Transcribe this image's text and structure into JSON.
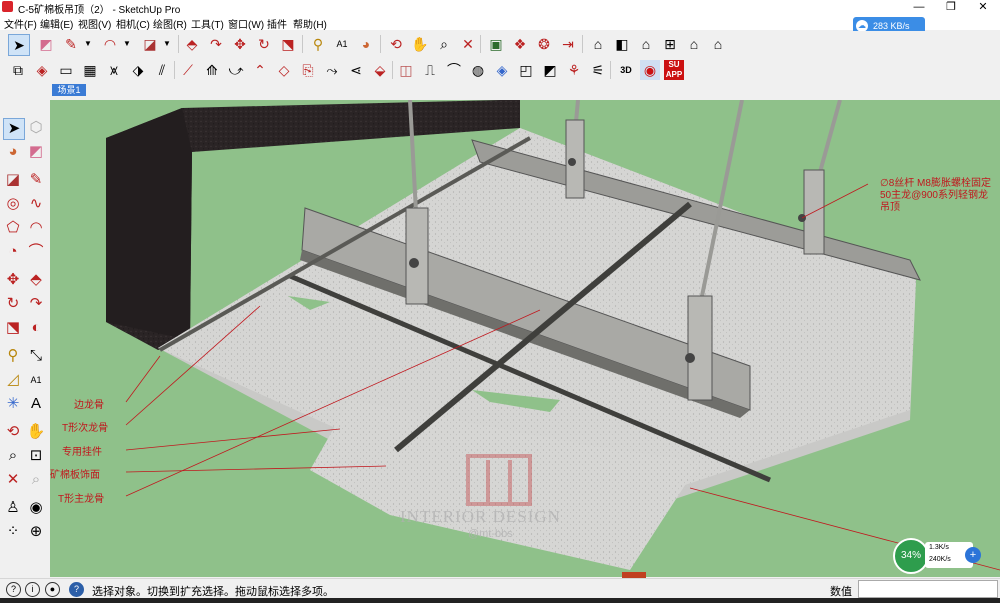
{
  "window": {
    "title": "C-5矿棉板吊顶（2） - SketchUp Pro",
    "controls": {
      "minimize": "—",
      "maximize": "❐",
      "close": "✕"
    }
  },
  "menu": [
    "文件(F)",
    "编辑(E)",
    "视图(V)",
    "相机(C)",
    "绘图(R)",
    "工具(T)",
    "窗口(W)",
    "插件",
    "帮助(H)"
  ],
  "net_speed": "283 KB/s",
  "scene_tab": "场景1",
  "viewport": {
    "annotation_right_lines": [
      "∅8丝杆 M8膨胀螺栓固定",
      "50主龙@900系列轻钢龙",
      "吊顶"
    ],
    "labels_left": [
      "边龙骨",
      "T形次龙骨",
      "专用挂件",
      "矿棉板饰面",
      "T形主龙骨"
    ],
    "watermark_title": "INTERIOR DESIGN",
    "watermark_sub": "@mt-bbs"
  },
  "speed_widget": {
    "percent": "34%",
    "up": "1.3K/s",
    "down": "240K/s"
  },
  "status": {
    "text": "选择对象。切换到扩充选择。拖动鼠标选择多项。",
    "vcb_label": "数值",
    "ime": "中"
  },
  "colors": {
    "accent": "#3a7bd5",
    "annotation": "#c0181e",
    "wall": "#2c2527",
    "board": "#d9d9d7",
    "green": "#2e9d4d"
  }
}
